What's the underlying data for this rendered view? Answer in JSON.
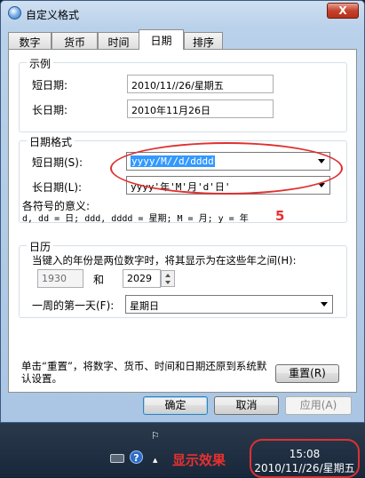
{
  "window": {
    "title": "自定义格式",
    "close_label": "X"
  },
  "tabs": [
    {
      "label": "数字"
    },
    {
      "label": "货币"
    },
    {
      "label": "时间"
    },
    {
      "label": "日期"
    },
    {
      "label": "排序"
    }
  ],
  "example": {
    "group_title": "示例",
    "short_label": "短日期:",
    "short_value": "2010/11//26/星期五",
    "long_label": "长日期:",
    "long_value": "2010年11月26日"
  },
  "date_format": {
    "group_title": "日期格式",
    "short_label": "短日期(S):",
    "short_value": "yyyy/M//d/dddd",
    "long_label": "长日期(L):",
    "long_value": "yyyy'年'M'月'd'日'",
    "symbols_title": "各符号的意义:",
    "symbols_text": "d, dd = 日;  ddd, dddd = 星期;  M = 月;  y = 年"
  },
  "calendar": {
    "group_title": "日历",
    "two_digit_label": "当键入的年份是两位数字时，将其显示为在这些年之间(H):",
    "year_from": "1930",
    "and_label": "和",
    "year_to": "2029",
    "first_day_label": "一周的第一天(F):",
    "first_day_value": "星期日"
  },
  "reset": {
    "description": "单击“重置”，将数字、货币、时间和日期还原到系统默认设置。",
    "button_label": "重置(R)"
  },
  "footer": {
    "ok_label": "确定",
    "cancel_label": "取消",
    "apply_label": "应用(A)"
  },
  "annotations": {
    "number": "5",
    "effect_label": "显示效果",
    "color": "#e83030"
  },
  "taskbar": {
    "time": "15:08",
    "date": "2010/11//26/星期五",
    "help_glyph": "?",
    "flag_glyph": "⚐",
    "chevron_glyph": "▲"
  }
}
